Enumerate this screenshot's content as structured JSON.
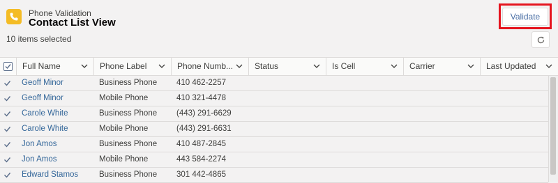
{
  "header": {
    "app_name": "Phone Validation",
    "view_title": "Contact List View",
    "selected_count": "10 items selected",
    "validate_label": "Validate"
  },
  "colors": {
    "app_icon": "#f4bc25",
    "highlight_border": "#e5141e",
    "link": "#336699"
  },
  "table": {
    "columns": [
      "Full Name",
      "Phone Label",
      "Phone Numb...",
      "Status",
      "Is Cell",
      "Carrier",
      "Last Updated"
    ],
    "rows": [
      {
        "checked": true,
        "full_name": "Geoff Minor",
        "phone_label": "Business Phone",
        "phone_number": "410 462-2257"
      },
      {
        "checked": true,
        "full_name": "Geoff Minor",
        "phone_label": "Mobile Phone",
        "phone_number": "410 321-4478"
      },
      {
        "checked": true,
        "full_name": "Carole White",
        "phone_label": "Business Phone",
        "phone_number": "(443) 291-6629"
      },
      {
        "checked": true,
        "full_name": "Carole White",
        "phone_label": "Mobile Phone",
        "phone_number": "(443) 291-6631"
      },
      {
        "checked": true,
        "full_name": "Jon Amos",
        "phone_label": "Business Phone",
        "phone_number": "410 487-2845"
      },
      {
        "checked": true,
        "full_name": "Jon Amos",
        "phone_label": "Mobile Phone",
        "phone_number": "443 584-2274"
      },
      {
        "checked": true,
        "full_name": "Edward Stamos",
        "phone_label": "Business Phone",
        "phone_number": "301 442-4865"
      }
    ]
  }
}
